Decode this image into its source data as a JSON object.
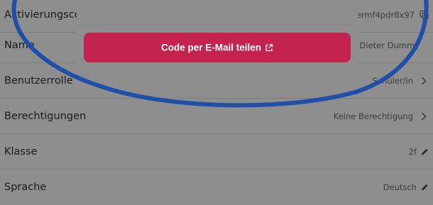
{
  "dialog": {
    "share_button_label": "Code per E-Mail teilen",
    "share_icon": "external-link-icon",
    "button_color": "#c4224f"
  },
  "rows": {
    "activation_code": {
      "label": "Aktivierungscode",
      "value": "ermf4pdr8x97",
      "icon": "copy-icon"
    },
    "name": {
      "label": "Name",
      "value": "Dieter Dummy"
    },
    "user_role": {
      "label": "Benutzerrolle",
      "value": "Schüler/in",
      "icon": "chevron-right-icon"
    },
    "permissions": {
      "label": "Berechtigungen",
      "value": "Keine Berechtigung",
      "icon": "chevron-right-icon"
    },
    "class": {
      "label": "Klasse",
      "value": "2f",
      "icon": "pencil-icon"
    },
    "language": {
      "label": "Sprache",
      "value": "Deutsch",
      "icon": "pencil-icon"
    }
  },
  "annotation": {
    "stroke_color": "#1f4fa8"
  }
}
